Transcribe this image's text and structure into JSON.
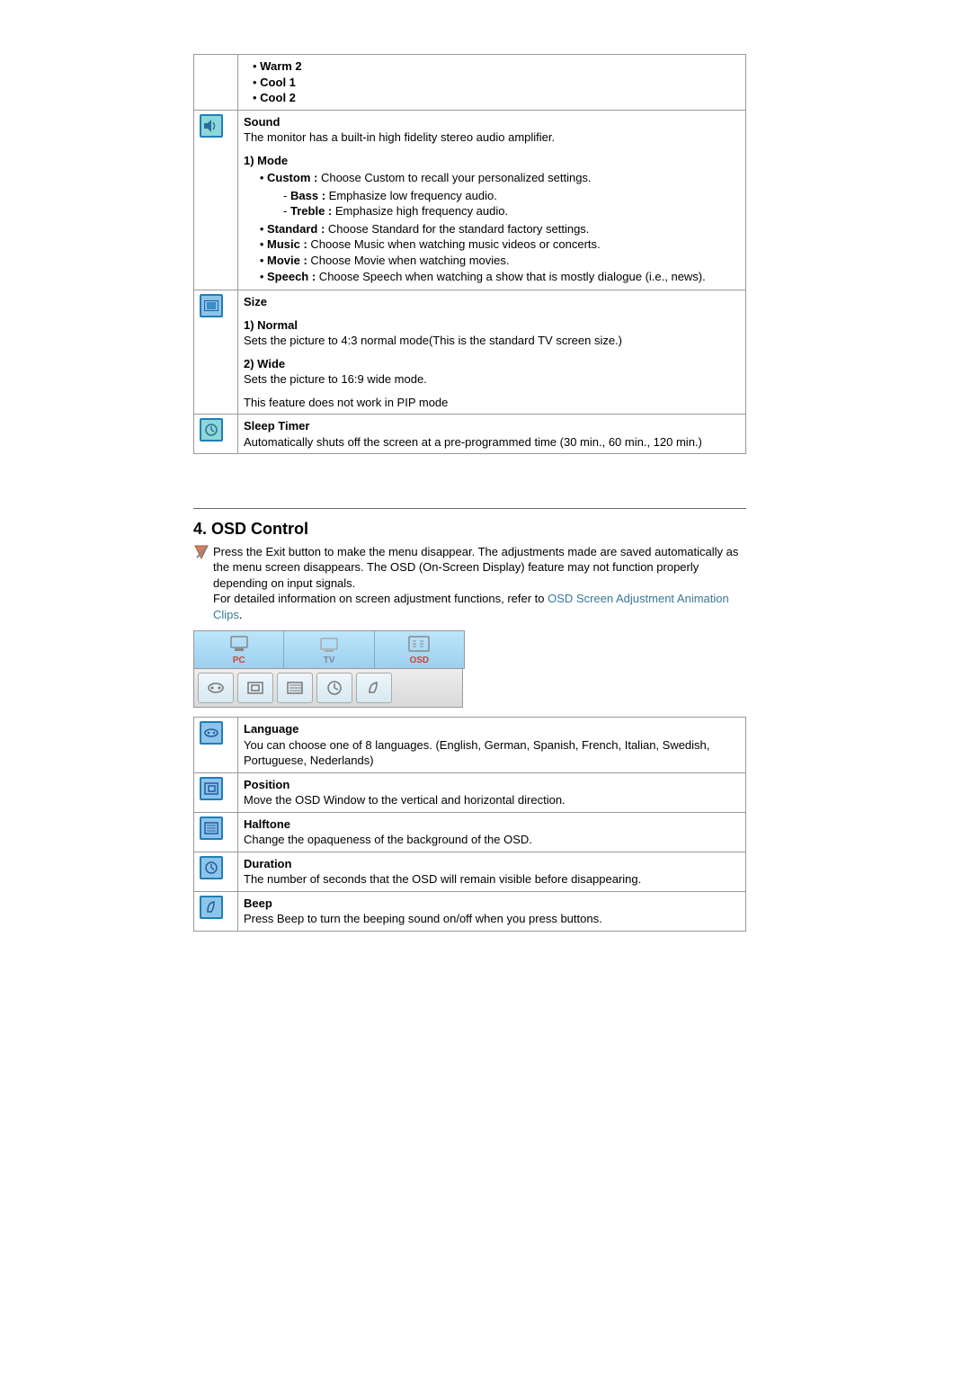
{
  "topRow": {
    "items": [
      "Warm 2",
      "Cool 1",
      "Cool 2"
    ]
  },
  "sound": {
    "title": "Sound",
    "desc": "The monitor has a built-in high fidelity stereo audio amplifier.",
    "modeLabel": "1) Mode",
    "customLabel": "Custom :",
    "customText": " Choose Custom to recall your personalized settings.",
    "bassLabel": "Bass :",
    "bassText": " Emphasize low frequency audio.",
    "trebleLabel": "Treble :",
    "trebleText": " Emphasize high frequency audio.",
    "standardLabel": "Standard :",
    "standardText": " Choose Standard for the standard factory settings.",
    "musicLabel": "Music :",
    "musicText": " Choose Music when watching music videos or concerts.",
    "movieLabel": "Movie :",
    "movieText": " Choose Movie when watching movies.",
    "speechLabel": "Speech :",
    "speechText": " Choose Speech when watching a show that is mostly dialogue (i.e., news)."
  },
  "size": {
    "title": "Size",
    "normalLabel": "1) Normal",
    "normalText": "Sets the picture to 4:3 normal mode(This is the standard TV screen size.)",
    "wideLabel": "2) Wide",
    "wideText": "Sets the picture to 16:9 wide mode.",
    "note": "This feature does not work in PIP mode"
  },
  "sleep": {
    "title": "Sleep Timer",
    "text": "Automatically shuts off the screen at a pre-programmed time (30 min., 60 min., 120 min.)"
  },
  "osd": {
    "heading": "4. OSD Control",
    "introA": "Press the Exit button to make the menu disappear. The adjustments made are saved automatically as the menu screen disappears. The OSD (On-Screen Display) feature may not function properly depending on input signals.",
    "introB": "For detailed information on screen adjustment functions, refer to ",
    "linkText": "OSD Screen Adjustment Animation Clips",
    "dot": ".",
    "tabs": {
      "pc": "PC",
      "tv": "TV",
      "osd": "OSD"
    },
    "rows": {
      "language": {
        "title": "Language",
        "text": "You can choose one of 8 languages. (English, German, Spanish, French, Italian, Swedish, Portuguese, Nederlands)"
      },
      "position": {
        "title": "Position",
        "text": "Move the OSD Window to the vertical and horizontal direction."
      },
      "halftone": {
        "title": "Halftone",
        "text": "Change the opaqueness of the background of the OSD."
      },
      "duration": {
        "title": "Duration",
        "text": "The number of seconds that the OSD will remain visible before disappearing."
      },
      "beep": {
        "title": "Beep",
        "text": "Press Beep to turn the beeping sound on/off when you press buttons."
      }
    }
  }
}
